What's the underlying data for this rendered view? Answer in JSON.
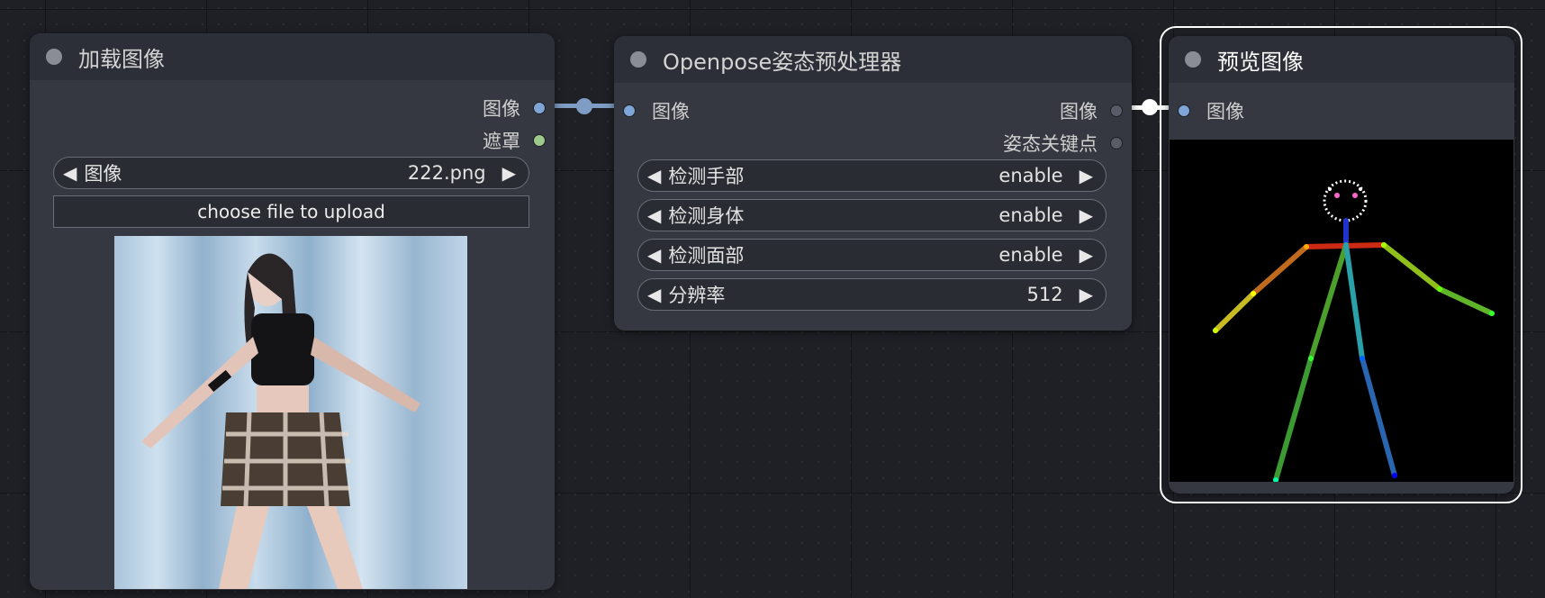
{
  "colors": {
    "canvas_bg": "#1e2026",
    "node_body": "#353841",
    "node_header": "#2c2f37",
    "image_port": "#7fa4d6",
    "mask_port": "#9ec98a",
    "keypoints_port": "#595c66",
    "selection_outline": "#ffffff"
  },
  "load_image": {
    "title": "加载图像",
    "outputs": [
      {
        "label": "图像",
        "type": "image"
      },
      {
        "label": "遮罩",
        "type": "mask"
      }
    ],
    "image_widget": {
      "label": "图像",
      "value": "222.png"
    },
    "upload_label": "choose file to upload",
    "preview_icon": "photo-of-dancer"
  },
  "openpose": {
    "title": "Openpose姿态预处理器",
    "input": {
      "label": "图像"
    },
    "outputs": [
      {
        "label": "图像",
        "type": "image"
      },
      {
        "label": "姿态关键点",
        "type": "keypoints"
      }
    ],
    "widgets": [
      {
        "label": "检测手部",
        "value": "enable"
      },
      {
        "label": "检测身体",
        "value": "enable"
      },
      {
        "label": "检测面部",
        "value": "enable"
      },
      {
        "label": "分辨率",
        "value": "512"
      }
    ]
  },
  "preview": {
    "title": "预览图像",
    "input": {
      "label": "图像"
    },
    "preview_icon": "openpose-skeleton"
  },
  "icons": {
    "arrow_left": "◀",
    "arrow_right": "▶"
  }
}
